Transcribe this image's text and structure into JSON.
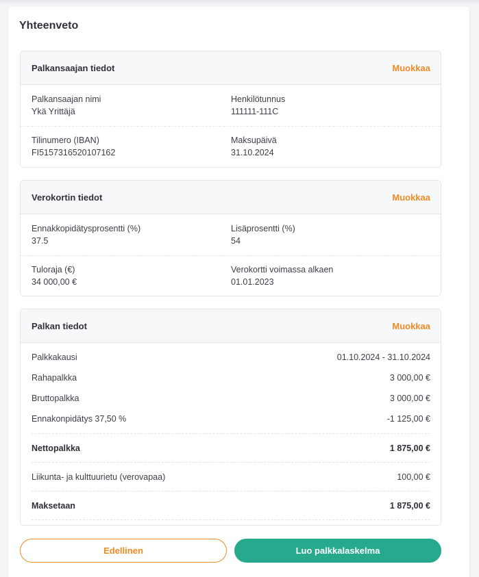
{
  "summary": {
    "title": "Yhteenveto"
  },
  "recipient": {
    "title": "Palkansaajan tiedot",
    "edit": "Muokkaa",
    "name_label": "Palkansaajan nimi",
    "name_value": "Ykä Yrittäjä",
    "ssn_label": "Henkilötunnus",
    "ssn_value": "111111-111C",
    "iban_label": "Tilinumero (IBAN)",
    "iban_value": "FI5157316520107162",
    "paydate_label": "Maksupäivä",
    "paydate_value": "31.10.2024"
  },
  "taxcard": {
    "title": "Verokortin tiedot",
    "edit": "Muokkaa",
    "withholding_label": "Ennakkopidätysprosentti (%)",
    "withholding_value": "37.5",
    "additional_label": "Lisäprosentti (%)",
    "additional_value": "54",
    "limit_label": "Tuloraja (€)",
    "limit_value": "34 000,00 €",
    "valid_label": "Verokortti voimassa alkaen",
    "valid_value": "01.01.2023"
  },
  "salary": {
    "title": "Palkan tiedot",
    "edit": "Muokkaa",
    "rows": [
      {
        "label": "Palkkakausi",
        "value": "01.10.2024 - 31.10.2024"
      },
      {
        "label": "Rahapalkka",
        "value": "3 000,00 €"
      },
      {
        "label": "Bruttopalkka",
        "value": "3 000,00 €"
      },
      {
        "label": "Ennakonpidätys 37,50 %",
        "value": "-1 125,00 €"
      }
    ],
    "net_label": "Nettopalkka",
    "net_value": "1 875,00 €",
    "benefit_label": "Liikunta- ja kulttuurietu (verovapaa)",
    "benefit_value": "100,00 €",
    "pay_label": "Maksetaan",
    "pay_value": "1 875,00 €"
  },
  "buttons": {
    "previous": "Edellinen",
    "create": "Luo palkkalaskelma"
  },
  "colors": {
    "accent_orange": "#f08a24",
    "primary_green": "#26a98c"
  }
}
